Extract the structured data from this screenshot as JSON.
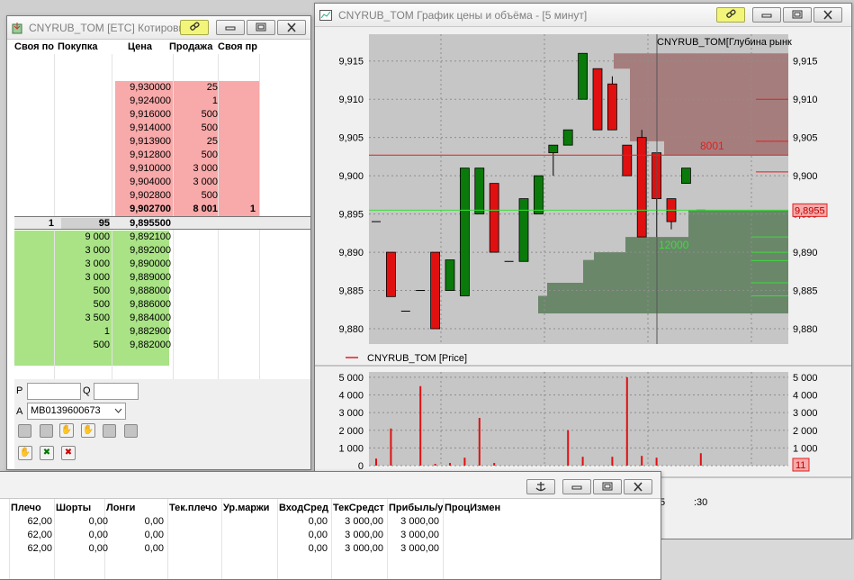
{
  "quote_window": {
    "title": "CNYRUB_TOM [ETC] Котировк",
    "columns": [
      "Своя по",
      "Покупка",
      "Цена",
      "Продажа",
      "Своя пр"
    ],
    "asks": [
      {
        "price": "9,930000",
        "sell": "25"
      },
      {
        "price": "9,924000",
        "sell": "1"
      },
      {
        "price": "9,916000",
        "sell": "500"
      },
      {
        "price": "9,914000",
        "sell": "500"
      },
      {
        "price": "9,913900",
        "sell": "25"
      },
      {
        "price": "9,912800",
        "sell": "500"
      },
      {
        "price": "9,910000",
        "sell": "3 000"
      },
      {
        "price": "9,904000",
        "sell": "3 000"
      },
      {
        "price": "9,902800",
        "sell": "500"
      },
      {
        "price": "9,902700",
        "sell": "8 001",
        "own": "1"
      }
    ],
    "current": {
      "own": "1",
      "buy": "95",
      "price": "9,895500"
    },
    "bids": [
      {
        "buy": "9 000",
        "price": "9,892100"
      },
      {
        "buy": "3 000",
        "price": "9,892000"
      },
      {
        "buy": "3 000",
        "price": "9,890000"
      },
      {
        "buy": "3 000",
        "price": "9,889000"
      },
      {
        "buy": "500",
        "price": "9,888000"
      },
      {
        "buy": "500",
        "price": "9,886000"
      },
      {
        "buy": "3 500",
        "price": "9,884000"
      },
      {
        "buy": "1",
        "price": "9,882900"
      },
      {
        "buy": "500",
        "price": "9,882000"
      }
    ],
    "form": {
      "p_label": "P",
      "q_label": "Q",
      "a_label": "A",
      "account": "MB0139600673"
    }
  },
  "chart_window": {
    "title": "CNYRUB_TOM График цены и объёма - [5 минут]",
    "depth_label": "CNYRUB_TOM[Глубина рынк",
    "legend": "CNYRUB_TOM [Price]",
    "ask_volume_label": "8001",
    "bid_volume_label": "12000",
    "last_price_tag": "9,8955",
    "volume_tag": "11",
    "time_labels": [
      ":5",
      ":30"
    ]
  },
  "chart_data": {
    "type": "candlestick",
    "y_ticks": [
      "9,915",
      "9,910",
      "9,905",
      "9,900",
      "9,895",
      "9,890",
      "9,885",
      "9,880"
    ],
    "ylim": [
      9.878,
      9.9185
    ],
    "candles": [
      {
        "o": 9.894,
        "h": 9.894,
        "l": 9.894,
        "c": 9.894
      },
      {
        "o": 9.89,
        "h": 9.89,
        "l": 9.8842,
        "c": 9.8842
      },
      {
        "o": 9.8823,
        "h": 9.8823,
        "l": 9.8823,
        "c": 9.8823
      },
      {
        "o": 9.885,
        "h": 9.885,
        "l": 9.885,
        "c": 9.885
      },
      {
        "o": 9.89,
        "h": 9.89,
        "l": 9.88,
        "c": 9.88
      },
      {
        "o": 9.885,
        "h": 9.889,
        "l": 9.885,
        "c": 9.889
      },
      {
        "o": 9.8843,
        "h": 9.901,
        "l": 9.8843,
        "c": 9.901
      },
      {
        "o": 9.895,
        "h": 9.901,
        "l": 9.895,
        "c": 9.901
      },
      {
        "o": 9.899,
        "h": 9.899,
        "l": 9.89,
        "c": 9.89
      },
      {
        "o": 9.8888,
        "h": 9.8888,
        "l": 9.8888,
        "c": 9.8888
      },
      {
        "o": 9.8888,
        "h": 9.897,
        "l": 9.8888,
        "c": 9.897
      },
      {
        "o": 9.895,
        "h": 9.9,
        "l": 9.895,
        "c": 9.9
      },
      {
        "o": 9.903,
        "h": 9.904,
        "l": 9.9,
        "c": 9.904
      },
      {
        "o": 9.904,
        "h": 9.906,
        "l": 9.904,
        "c": 9.906
      },
      {
        "o": 9.91,
        "h": 9.916,
        "l": 9.91,
        "c": 9.916
      },
      {
        "o": 9.914,
        "h": 9.914,
        "l": 9.906,
        "c": 9.906
      },
      {
        "o": 9.912,
        "h": 9.913,
        "l": 9.906,
        "c": 9.906
      },
      {
        "o": 9.904,
        "h": 9.904,
        "l": 9.9,
        "c": 9.9
      },
      {
        "o": 9.905,
        "h": 9.906,
        "l": 9.892,
        "c": 9.892
      },
      {
        "o": 9.903,
        "h": 9.903,
        "l": 9.892,
        "c": 9.897
      },
      {
        "o": 9.897,
        "h": 9.897,
        "l": 9.893,
        "c": 9.894
      },
      {
        "o": 9.899,
        "h": 9.901,
        "l": 9.899,
        "c": 9.901
      },
      {
        "o": 9.8955,
        "h": 9.8955,
        "l": 9.8955,
        "c": 9.8955
      }
    ],
    "volume_ticks": [
      "5 000",
      "4 000",
      "3 000",
      "2 000",
      "1 000",
      "0"
    ],
    "volume_lim": [
      0,
      5300
    ],
    "volumes": [
      400,
      2100,
      0,
      4500,
      100,
      150,
      450,
      2700,
      150,
      0,
      0,
      0,
      0,
      2000,
      500,
      0,
      500,
      5000,
      550,
      450,
      0,
      0,
      700
    ],
    "ask_depth_price": 9.9027,
    "bid_depth_price": 9.8955,
    "last_price": 9.8955,
    "grid": true
  },
  "positions_window": {
    "columns": [
      "Плечо",
      "Шорты",
      "Лонги",
      "Тек.плечо",
      "Ур.маржи",
      "ВходСред",
      "ТекСредст",
      "Прибыль/у",
      "ПроцИзмен"
    ],
    "rows": [
      [
        "62,00",
        "0,00",
        "0,00",
        "",
        "",
        "0,00",
        "3 000,00",
        "3 000,00",
        ""
      ],
      [
        "62,00",
        "0,00",
        "0,00",
        "",
        "",
        "0,00",
        "3 000,00",
        "3 000,00",
        ""
      ],
      [
        "62,00",
        "0,00",
        "0,00",
        "",
        "",
        "0,00",
        "3 000,00",
        "3 000,00",
        ""
      ]
    ]
  },
  "colors": {
    "ask": "#f8a9a9",
    "bid": "#a9e386",
    "bull": "#0a7a0a",
    "bear": "#e01010",
    "highlight": "#f2f57a"
  }
}
